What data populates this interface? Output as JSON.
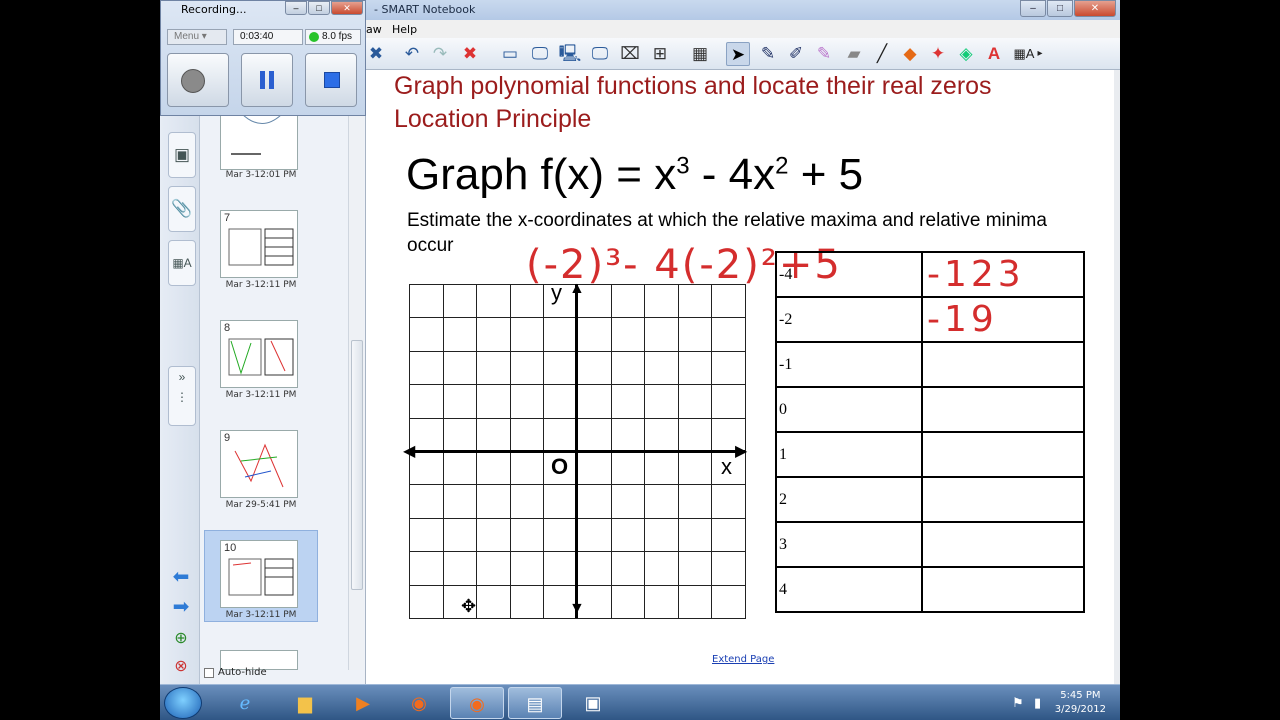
{
  "window": {
    "title": "- SMART Notebook",
    "min": "–",
    "max": "□",
    "close": "✕"
  },
  "menu": {
    "items": [
      "aw",
      "Help"
    ]
  },
  "recorder": {
    "title": "Recording...",
    "menu_label": "Menu",
    "elapsed": "0:03:40",
    "fps": "8.0 fps"
  },
  "sidepanel": {
    "pages": [
      {
        "num": "",
        "date": "Mar 3-12:01 PM"
      },
      {
        "num": "7",
        "date": "Mar 3-12:11 PM"
      },
      {
        "num": "8",
        "date": "Mar 3-12:11 PM"
      },
      {
        "num": "9",
        "date": "Mar 29-5:41 PM"
      },
      {
        "num": "10",
        "date": "Mar 3-12:11 PM"
      }
    ],
    "autohide_label": "Auto-hide"
  },
  "page": {
    "header_line1": "Graph polynomial functions and locate their real zeros",
    "header_line2": "Location Principle",
    "heading_pre": "Graph f(x) = x",
    "exp1": "3",
    "heading_mid": " - 4x",
    "exp2": "2",
    "heading_post": " + 5",
    "task": "Estimate the x-coordinates at which the relative maxima and relative minima occur",
    "ink_work": "(-2)³- 4(-2)²+5",
    "graph": {
      "origin_label": "O",
      "x_label": "x",
      "y_label": "y"
    },
    "table": {
      "rows": [
        {
          "x": "-4",
          "y": "-123"
        },
        {
          "x": "-2",
          "y": "-19"
        },
        {
          "x": "-1",
          "y": ""
        },
        {
          "x": "0",
          "y": ""
        },
        {
          "x": "1",
          "y": ""
        },
        {
          "x": "2",
          "y": ""
        },
        {
          "x": "3",
          "y": ""
        },
        {
          "x": "4",
          "y": ""
        }
      ]
    },
    "extend_link": "Extend Page"
  },
  "taskbar": {
    "time": "5:45 PM",
    "date": "3/29/2012"
  }
}
